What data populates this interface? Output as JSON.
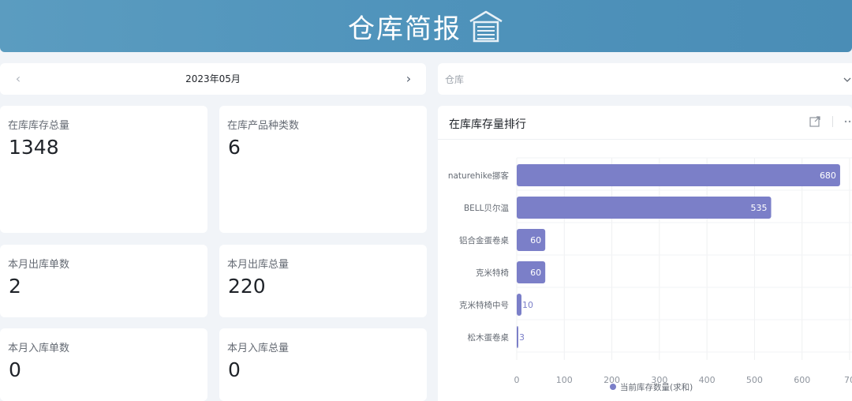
{
  "header": {
    "title": "仓库简报",
    "icon": "warehouse-icon"
  },
  "date_picker": {
    "value": "2023年05月",
    "prev_icon": "chevron-left-icon",
    "next_icon": "chevron-right-icon"
  },
  "warehouse_select": {
    "placeholder": "仓库",
    "icon": "chevron-down-icon"
  },
  "kpis": [
    {
      "label": "在库库存总量",
      "value": "1348"
    },
    {
      "label": "在库产品种类数",
      "value": "6"
    },
    {
      "label": "本月出库单数",
      "value": "2"
    },
    {
      "label": "本月出库总量",
      "value": "220"
    },
    {
      "label": "本月入库单数",
      "value": "0"
    },
    {
      "label": "本月入库总量",
      "value": "0"
    }
  ],
  "chart_panel": {
    "title": "在库库存量排行",
    "actions": [
      "expand-icon",
      "more-icon"
    ]
  },
  "chart_data": {
    "type": "bar",
    "orientation": "horizontal",
    "categories": [
      "naturehike挪客",
      "BELL贝尔温",
      "铝合金蛋卷桌",
      "克米特椅",
      "克米特椅中号",
      "松木蛋卷桌"
    ],
    "series": [
      {
        "name": "当前库存数量(求和)",
        "values": [
          680,
          535,
          60,
          60,
          10,
          3
        ]
      }
    ],
    "x_ticks": [
      "0",
      "100",
      "200",
      "300",
      "400",
      "500",
      "600",
      "70"
    ],
    "xlim": [
      0,
      700
    ],
    "grid": true,
    "legend": "bottom",
    "bar_color": "#7b7fc8"
  }
}
